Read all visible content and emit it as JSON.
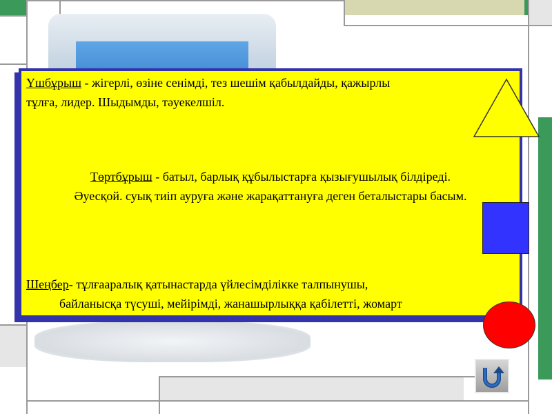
{
  "slide": {
    "triangle": {
      "term": "Үшбұрыш",
      "line1": " - жігерлі, өзіне сенімді, тез шешім қабылдайды, қажырлы",
      "line2": "тұлға, лидер. Шыдымды, тәуекелшіл."
    },
    "square": {
      "term": "Төртбұрыш",
      "line1": " - батыл, барлық құбылыстарға қызығушылық білдіреді.",
      "line2": "Әуесқой. суық тиіп ауруға және жарақаттануға деген беталыстары басым."
    },
    "circle": {
      "term": "Шеңбер",
      "line1": "- тұлғааралық қатынастарда үйлесімділікке талпынушы,",
      "line2": "байланысқа түсуші, мейірімді, жанашырлыққа қабілетті, жомарт"
    }
  },
  "shapes": {
    "triangle_color": "#ffff00",
    "square_color": "#3333ff",
    "circle_color": "#ff0000"
  },
  "nav": {
    "icon": "return-arrow-icon"
  }
}
